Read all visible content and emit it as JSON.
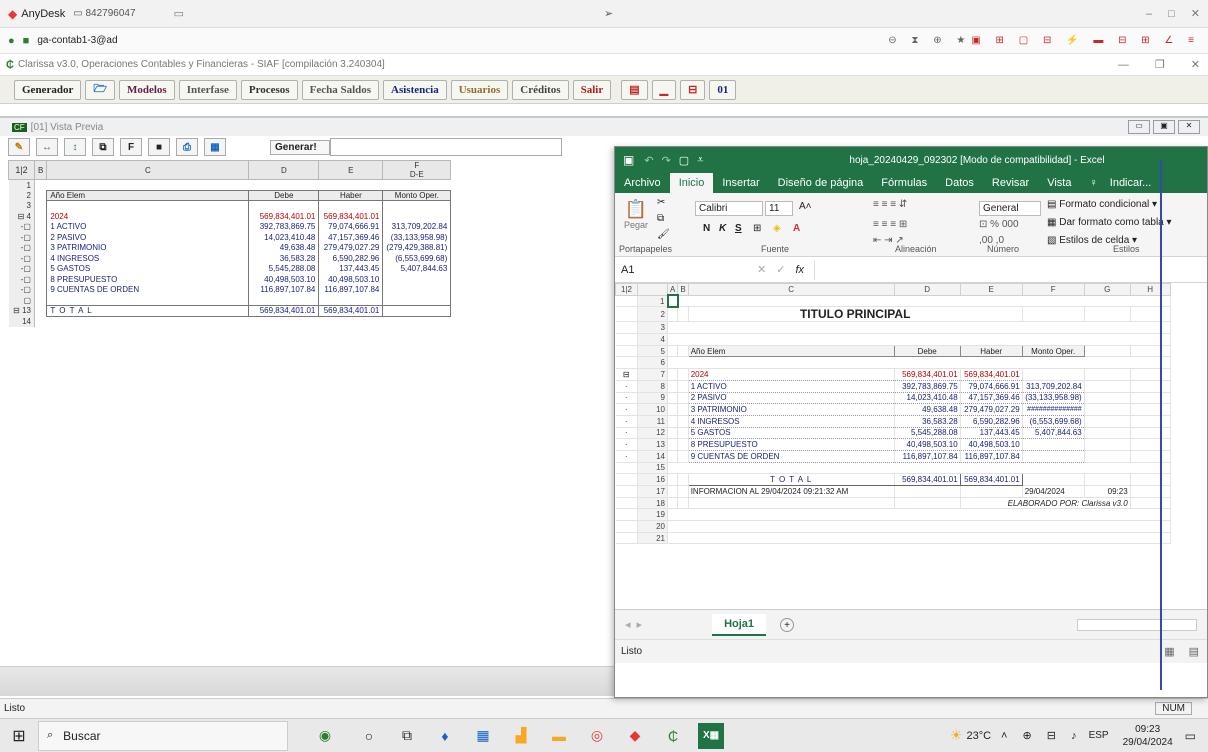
{
  "anydesk": {
    "app_name": "AnyDesk",
    "id": "842796047"
  },
  "address": {
    "host": "ga-contab1-3@ad"
  },
  "clarissa": {
    "title": "Clarissa v3.0, Operaciones Contables y Financieras - SIAF  [compilación 3.240304]",
    "menu": [
      "Generador",
      "Modelos",
      "Interfase",
      "Procesos",
      "Fecha Saldos",
      "Asistencia",
      "Usuarios",
      "Créditos",
      "Salir"
    ],
    "badge": "01"
  },
  "vista": {
    "title": "[01] Vista Previa",
    "generar_label": "Generar!",
    "status": "Listo",
    "toolbar_f": "F",
    "cols": [
      "B",
      "C",
      "D",
      "E",
      "F"
    ],
    "col_f_sub": "D-E",
    "headers": {
      "anio": "Año Elem",
      "debe": "Debe",
      "haber": "Haber",
      "monto": "Monto Oper."
    },
    "year_row": {
      "label": "2024",
      "debe": "569,834,401.01",
      "haber": "569,834,401.01"
    },
    "rows": [
      {
        "label": "1  ACTIVO",
        "debe": "392,783,869.75",
        "haber": "79,074,666.91",
        "monto": "313,709,202.84"
      },
      {
        "label": "2  PASIVO",
        "debe": "14,023,410.48",
        "haber": "47,157,369.46",
        "monto": "(33,133,958.98)"
      },
      {
        "label": "3  PATRIMONIO",
        "debe": "49,638.48",
        "haber": "279,479,027.29",
        "monto": "(279,429,388.81)"
      },
      {
        "label": "4  INGRESOS",
        "debe": "36,583.28",
        "haber": "6,590,282.96",
        "monto": "(6,553,699.68)"
      },
      {
        "label": "5  GASTOS",
        "debe": "5,545,288.08",
        "haber": "137,443.45",
        "monto": "5,407,844.63"
      },
      {
        "label": "8  PRESUPUESTO",
        "debe": "40,498,503.10",
        "haber": "40,498,503.10",
        "monto": ""
      },
      {
        "label": "9  CUENTAS DE ORDEN",
        "debe": "116,897,107.84",
        "haber": "116,897,107.84",
        "monto": ""
      }
    ],
    "total": {
      "label": "T O T A L",
      "debe": "569,834,401.01",
      "haber": "569,834,401.01"
    }
  },
  "excel": {
    "title": "hoja_20240429_092302  [Modo de compatibilidad] - Excel",
    "tabs": [
      "Archivo",
      "Inicio",
      "Insertar",
      "Diseño de página",
      "Fórmulas",
      "Datos",
      "Revisar",
      "Vista",
      "Indicar..."
    ],
    "ribbon": {
      "font": "Calibri",
      "size": "11",
      "number_format": "General",
      "pegar": "Pegar",
      "portapapeles": "Portapapeles",
      "fuente": "Fuente",
      "alineacion": "Alineación",
      "numero": "Número",
      "estilos": "Estilos",
      "cond": "Formato condicional",
      "tabla": "Dar formato como tabla",
      "celda": "Estilos de celda"
    },
    "namebox": "A1",
    "fx": "fx",
    "cols": [
      "A",
      "B",
      "C",
      "D",
      "E",
      "F",
      "G",
      "H"
    ],
    "heading": "TITULO PRINCIPAL",
    "headers": {
      "anio": "Año Elem",
      "debe": "Debe",
      "haber": "Haber",
      "monto": "Monto Oper."
    },
    "year_row": {
      "label": "2024",
      "debe": "569,834,401.01",
      "haber": "569,834,401.01"
    },
    "rows": [
      {
        "label": "1  ACTIVO",
        "debe": "392,783,869.75",
        "haber": "79,074,666.91",
        "monto": "313,709,202.84"
      },
      {
        "label": "2  PASIVO",
        "debe": "14,023,410.48",
        "haber": "47,157,369.46",
        "monto": "(33,133,958.98)"
      },
      {
        "label": "3  PATRIMONIO",
        "debe": "49,638.48",
        "haber": "279,479,027.29",
        "monto": "##############"
      },
      {
        "label": "4  INGRESOS",
        "debe": "36,583.28",
        "haber": "6,590,282.96",
        "monto": "(6,553,699.68)"
      },
      {
        "label": "5  GASTOS",
        "debe": "5,545,288.08",
        "haber": "137,443.45",
        "monto": "5,407,844.63"
      },
      {
        "label": "8  PRESUPUESTO",
        "debe": "40,498,503.10",
        "haber": "40,498,503.10",
        "monto": ""
      },
      {
        "label": "9  CUENTAS DE ORDEN",
        "debe": "116,897,107.84",
        "haber": "116,897,107.84",
        "monto": ""
      }
    ],
    "total": {
      "label": "T O T A L",
      "debe": "569,834,401.01",
      "haber": "569,834,401.01"
    },
    "info": "INFORMACION AL 29/04/2024 09:21:32 AM",
    "date": "29/04/2024",
    "time": "09:23",
    "elaborado": "ELABORADO POR:",
    "author": "Clarissa v3.0",
    "sheet": "Hoja1",
    "status": "Listo",
    "num": "NUM"
  },
  "taskbar": {
    "search": "Buscar",
    "weather": "23°C",
    "lang": "ESP",
    "time": "09:23",
    "date": "29/04/2024"
  }
}
